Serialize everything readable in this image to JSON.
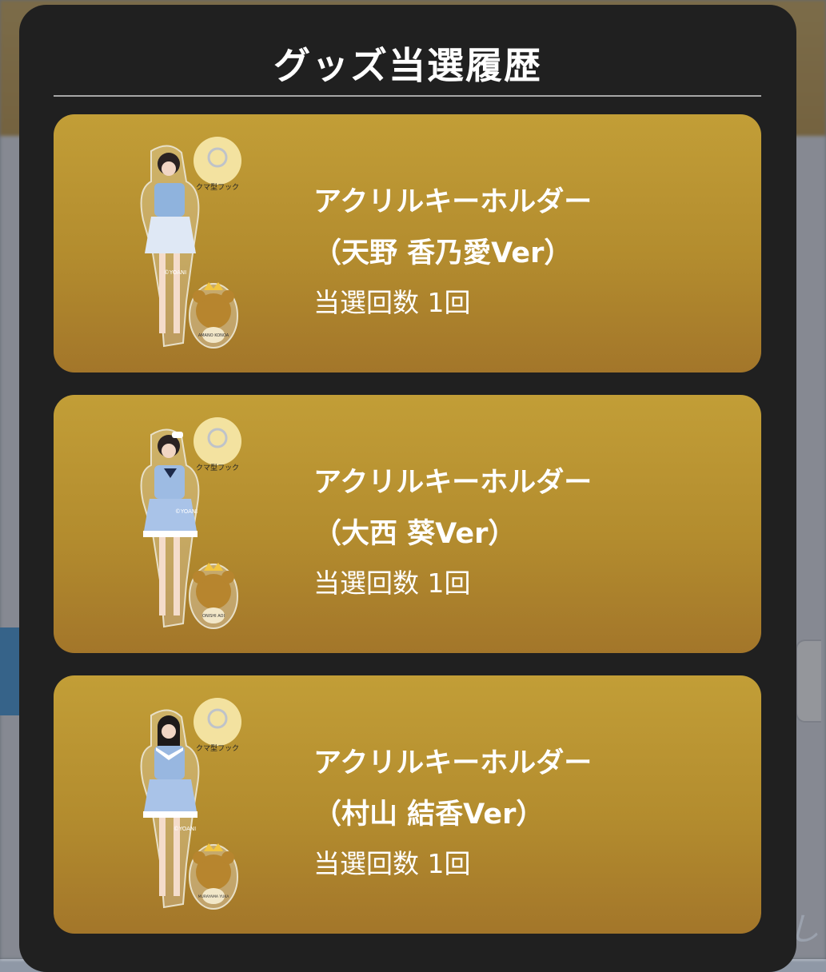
{
  "modal": {
    "title": "グッズ当選履歴"
  },
  "items": [
    {
      "name_line1": "アクリルキーホルダー",
      "name_line2": "（天野 香乃愛Ver）",
      "win_count": "当選回数 1回",
      "hook_label": "クマ型フック",
      "copyright": "©YOANI",
      "bear_name": "AMANO KONOA",
      "outfit_color": "#8fb3dd"
    },
    {
      "name_line1": "アクリルキーホルダー",
      "name_line2": "（大西 葵Ver）",
      "win_count": "当選回数 1回",
      "hook_label": "クマ型フック",
      "copyright": "©YOANI",
      "bear_name": "ONISHI AOI",
      "outfit_color": "#9dbbe3"
    },
    {
      "name_line1": "アクリルキーホルダー",
      "name_line2": "（村山 結香Ver）",
      "win_count": "当選回数 1回",
      "hook_label": "クマ型フック",
      "copyright": "©YOANI",
      "bear_name": "MURAYAMA YUKA",
      "outfit_color": "#98b7e0"
    }
  ],
  "colors": {
    "modal_bg": "#202020",
    "card_gold_top": "#c29e37",
    "card_gold_bottom": "#a3762a",
    "text": "#ffffff"
  }
}
